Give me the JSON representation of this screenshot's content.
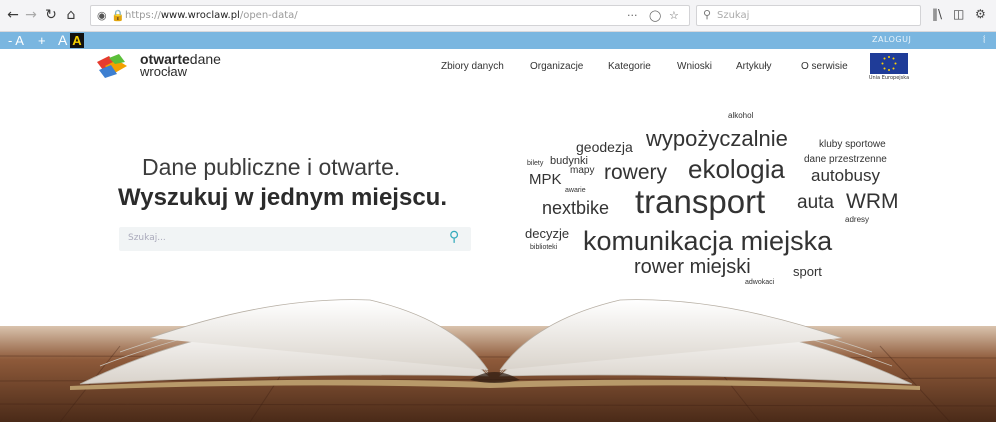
{
  "browser": {
    "url_prefix": "https://",
    "url_domain": "www.wroclaw.pl",
    "url_path": "/open-data/",
    "search_placeholder": "Szukaj",
    "url_more": "···"
  },
  "accessibility": {
    "font_decrease": "- A",
    "font_increase": "+",
    "font_normal": "A",
    "contrast": "A",
    "login": "ZALOGUJ"
  },
  "header": {
    "logo_bold": "otwarte",
    "logo_light": "dane",
    "logo_city": "wrocław",
    "menu": [
      "Zbiory danych",
      "Organizacje",
      "Kategorie",
      "Wnioski",
      "Artykuły",
      "O serwisie"
    ],
    "eu_label": "Unia Europejska"
  },
  "hero": {
    "line1": "Dane publiczne i otwarte.",
    "line2": "Wyszukuj w jednym miejscu.",
    "search_placeholder": "Szukaj..."
  },
  "tags": [
    "alkohol",
    "geodezja",
    "wypożyczalnie",
    "kluby sportowe",
    "bilety",
    "budynki",
    "dane przestrzenne",
    "MPK",
    "mapy",
    "rowery",
    "ekologia",
    "autobusy",
    "awarie",
    "nextbike",
    "transport",
    "auta",
    "WRM",
    "adresy",
    "decyzje",
    "komunikacja miejska",
    "biblioteki",
    "rower miejski",
    "sport",
    "adwokaci"
  ],
  "colors": {
    "acc_bar": "#7ab6e0",
    "contrast_fg": "#f5d000",
    "search_icon": "#33aabb",
    "eu_blue": "#1f3c98"
  }
}
